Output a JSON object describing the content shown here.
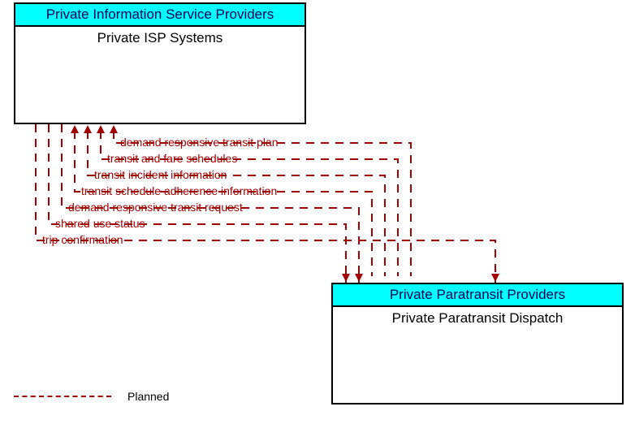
{
  "boxes": {
    "left": {
      "header": "Private Information Service Providers",
      "body": "Private ISP Systems"
    },
    "right": {
      "header": "Private Paratransit Providers",
      "body": "Private Paratransit Dispatch"
    }
  },
  "flows": [
    {
      "label": "demand responsive transit plan",
      "direction": "to_left"
    },
    {
      "label": "transit and fare schedules",
      "direction": "to_left"
    },
    {
      "label": "transit incident information",
      "direction": "to_left"
    },
    {
      "label": "transit schedule adherence information",
      "direction": "to_left"
    },
    {
      "label": "demand responsive transit request",
      "direction": "to_right"
    },
    {
      "label": "shared use status",
      "direction": "to_right"
    },
    {
      "label": "trip confirmation",
      "direction": "to_right"
    }
  ],
  "legend": {
    "planned": "Planned"
  },
  "style": {
    "stroke": "#a00000"
  }
}
